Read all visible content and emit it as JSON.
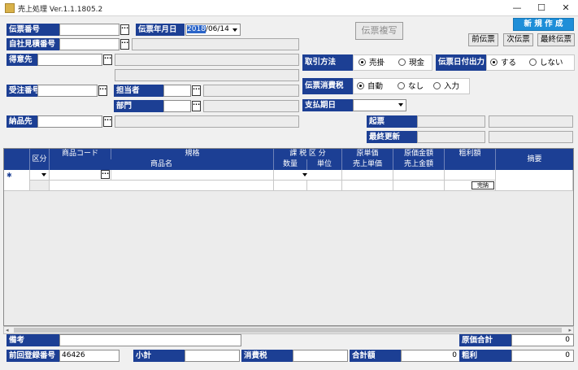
{
  "window": {
    "title": "売上処理 Ver.1.1.1805.2",
    "controls": {
      "minimize": "—",
      "maximize": "☐",
      "close": "✕"
    }
  },
  "header": {
    "denpyo_bango_label": "伝票番号",
    "denpyo_date_label": "伝票年月日",
    "denpyo_date_year": "2018",
    "denpyo_date_md": "/06/14",
    "jisha_mitsumori_label": "自社見積番号",
    "tokuisaki_label": "得意先",
    "juchu_bango_label": "受注番号",
    "tantousha_label": "担当者",
    "bumon_label": "部門",
    "nohinsaki_label": "納品先",
    "dots": "···"
  },
  "buttons": {
    "denpyo_copy": "伝票複写",
    "new": "新 規 作 成",
    "prev": "前伝票",
    "next": "次伝票",
    "last": "最終伝票"
  },
  "options": {
    "torihiki_label": "取引方法",
    "torihiki_options": [
      "売掛",
      "現金"
    ],
    "date_output_label": "伝票日付出力",
    "date_output_options": [
      "する",
      "しない"
    ],
    "tax_label": "伝票消費税",
    "tax_options": [
      "自動",
      "なし",
      "入力"
    ],
    "shiharai_label": "支払期日",
    "kiki_label": "起票",
    "saishu_label": "最終更新"
  },
  "table": {
    "headers_row1": [
      "区分",
      "商品コード",
      "規格",
      "課 税 区 分",
      "原単価",
      "原価金額",
      "粗利額",
      "摘要"
    ],
    "headers_row2": [
      "商品名",
      "数量",
      "単位",
      "売上単価",
      "売上金額"
    ],
    "row_marker": "✱",
    "kanno_button": "完納"
  },
  "footer": {
    "biko_label": "備考",
    "genka_total_label": "原価合計",
    "genka_total_value": "0",
    "zenkai_label": "前回登録番号",
    "zenkai_value": "46426",
    "shokei_label": "小計",
    "tax_label": "消費税",
    "total_label": "合計額",
    "total_value": "0",
    "arari_label": "粗利",
    "arari_value": "0"
  }
}
